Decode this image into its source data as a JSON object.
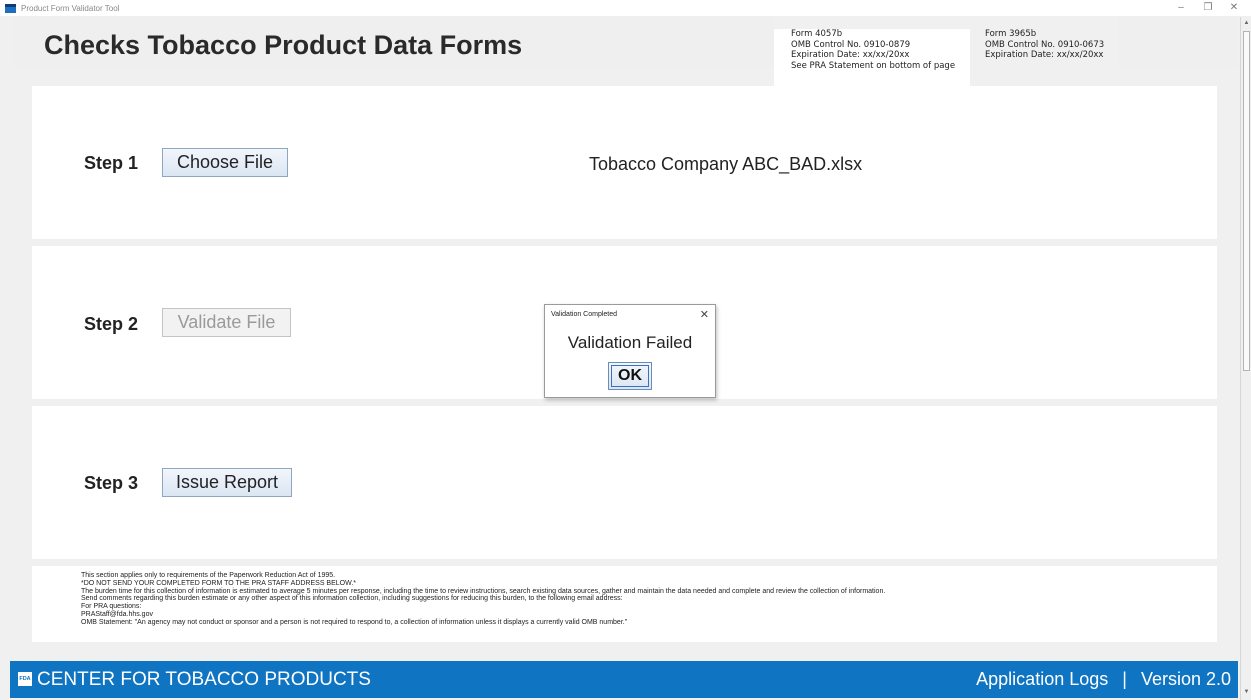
{
  "window": {
    "title": "Product Form Validator Tool",
    "minimize_glyph": "–",
    "restore_glyph": "❐",
    "close_glyph": "✕"
  },
  "header": {
    "title": "Checks Tobacco Product Data Forms",
    "form_a": {
      "line1": "Form 4057b",
      "line2": "OMB Control No. 0910-0879",
      "line3": "Expiration Date: xx/xx/20xx",
      "line4": "See PRA Statement on bottom of page"
    },
    "form_b": {
      "line1": "Form 3965b",
      "line2": "OMB Control No. 0910-0673",
      "line3": "Expiration Date: xx/xx/20xx"
    }
  },
  "steps": {
    "step1": {
      "label": "Step 1",
      "button": "Choose File",
      "file_name": "Tobacco Company ABC_BAD.xlsx"
    },
    "step2": {
      "label": "Step 2",
      "button": "Validate File"
    },
    "step3": {
      "label": "Step 3",
      "button": "Issue Report"
    }
  },
  "pra": {
    "lines": [
      "This section applies only to requirements of the Paperwork Reduction Act of 1995.",
      "*DO NOT SEND YOUR COMPLETED FORM TO THE PRA STAFF ADDRESS BELOW.*",
      "The burden time for this collection of information is estimated to average 5 minutes per response, including the time to review instructions, search existing data sources, gather and maintain the data needed and complete and review the collection of information.",
      "Send comments regarding this burden estimate or any other aspect of this information collection, including suggestions for reducing this burden, to the following email address:",
      "For PRA questions:",
      "PRAStaff@fda.hhs.gov",
      "OMB Statement: \"An agency may not conduct or sponsor and a person is not required to respond to, a collection of information unless it displays a currently valid OMB number.\""
    ]
  },
  "footer": {
    "logo_text": "FDA",
    "center_name": "CENTER FOR TOBACCO PRODUCTS",
    "logs_link": "Application Logs",
    "separator": "|",
    "version": "Version 2.0"
  },
  "dialog": {
    "title": "Validation Completed",
    "close_glyph": "✕",
    "message": "Validation Failed",
    "ok_label": "OK"
  },
  "colors": {
    "footer_blue": "#0f74c2",
    "button_border": "#8fa6c2"
  },
  "icons": [
    "app-icon",
    "fda-logo",
    "close-icon"
  ]
}
